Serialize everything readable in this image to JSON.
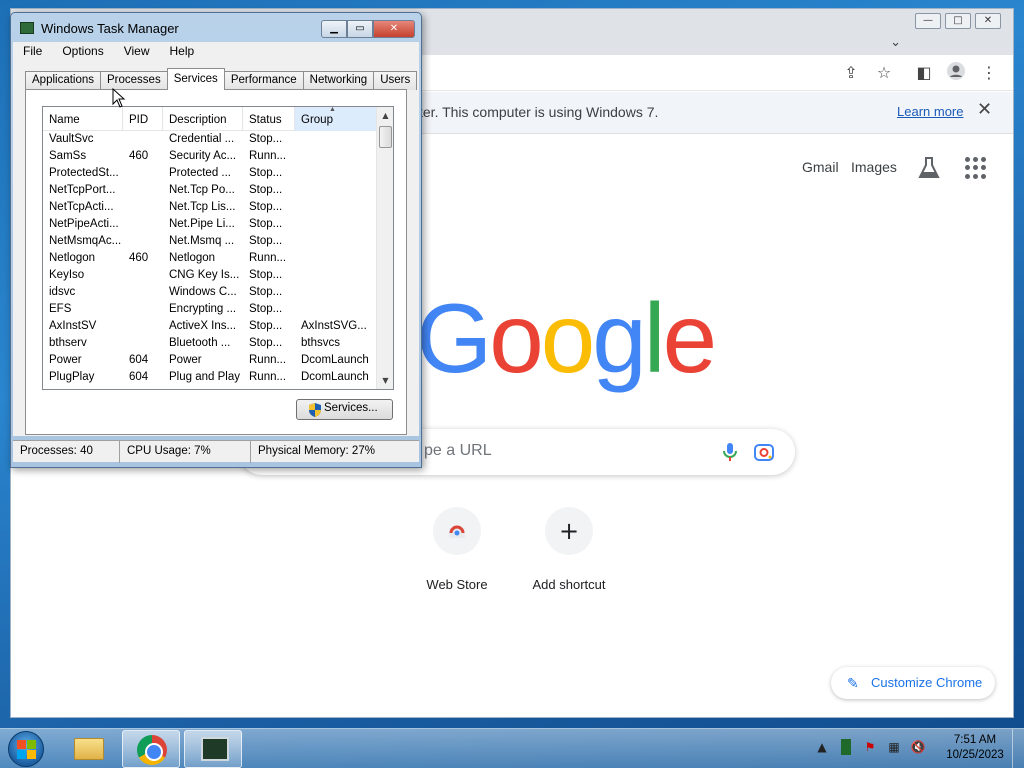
{
  "chrome": {
    "window_controls": [
      "—",
      "□",
      "✕"
    ],
    "infobar": {
      "text": "ter. This computer is using Windows 7.",
      "link": "Learn more",
      "close": "✕"
    },
    "top_links": [
      "Gmail",
      "Images"
    ],
    "search_placeholder": "pe a URL",
    "shortcuts": [
      {
        "label": "Web Store"
      },
      {
        "label": "Add shortcut",
        "glyph": "+"
      }
    ],
    "customize": "Customize Chrome",
    "logo_letters": [
      "G",
      "o",
      "o",
      "g",
      "l",
      "e"
    ],
    "logo_colors": [
      "#4285f4",
      "#ea4335",
      "#fbbc05",
      "#4285f4",
      "#34a853",
      "#ea4335"
    ]
  },
  "task_manager": {
    "title": "Windows Task Manager",
    "menu": [
      "File",
      "Options",
      "View",
      "Help"
    ],
    "tabs": [
      "Applications",
      "Processes",
      "Services",
      "Performance",
      "Networking",
      "Users"
    ],
    "active_tab": "Services",
    "columns": [
      "Name",
      "PID",
      "Description",
      "Status",
      "Group"
    ],
    "rows": [
      [
        "VaultSvc",
        "",
        "Credential ...",
        "Stop...",
        ""
      ],
      [
        "SamSs",
        "460",
        "Security Ac...",
        "Runn...",
        ""
      ],
      [
        "ProtectedSt...",
        "",
        "Protected ...",
        "Stop...",
        ""
      ],
      [
        "NetTcpPort...",
        "",
        "Net.Tcp Po...",
        "Stop...",
        ""
      ],
      [
        "NetTcpActi...",
        "",
        "Net.Tcp Lis...",
        "Stop...",
        ""
      ],
      [
        "NetPipeActi...",
        "",
        "Net.Pipe Li...",
        "Stop...",
        ""
      ],
      [
        "NetMsmqAc...",
        "",
        "Net.Msmq ...",
        "Stop...",
        ""
      ],
      [
        "Netlogon",
        "460",
        "Netlogon",
        "Runn...",
        ""
      ],
      [
        "KeyIso",
        "",
        "CNG Key Is...",
        "Stop...",
        ""
      ],
      [
        "idsvc",
        "",
        "Windows C...",
        "Stop...",
        ""
      ],
      [
        "EFS",
        "",
        "Encrypting ...",
        "Stop...",
        ""
      ],
      [
        "AxInstSV",
        "",
        "ActiveX Ins...",
        "Stop...",
        "AxInstSVG..."
      ],
      [
        "bthserv",
        "",
        "Bluetooth ...",
        "Stop...",
        "bthsvcs"
      ],
      [
        "Power",
        "604",
        "Power",
        "Runn...",
        "DcomLaunch"
      ],
      [
        "PlugPlay",
        "604",
        "Plug and Play",
        "Runn...",
        "DcomLaunch"
      ]
    ],
    "services_button": "Services...",
    "status": {
      "processes": "Processes: 40",
      "cpu": "CPU Usage: 7%",
      "memory": "Physical Memory: 27%"
    }
  },
  "taskbar": {
    "time": "7:51 AM",
    "date": "10/25/2023"
  }
}
